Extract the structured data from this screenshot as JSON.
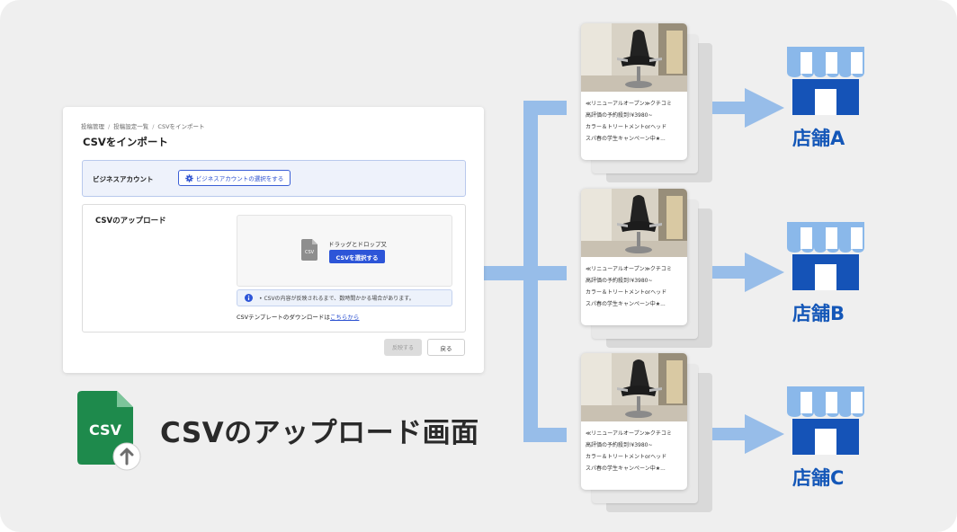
{
  "breadcrumb": [
    "投稿管理",
    "投稿設定一覧",
    "CSVをインポート"
  ],
  "page_title": "CSVをインポート",
  "business": {
    "label": "ビジネスアカウント",
    "button": "ビジネスアカウントの選択をする"
  },
  "upload": {
    "label": "CSVのアップロード",
    "file_icon_text": "CSV",
    "drop_text": "ドラッグとドロップ又",
    "select_button": "CSVを選択する",
    "info_text": "• CSVの内容が反映されるまで、数時間かかる場合があります。",
    "template_prefix": "CSVテンプレートのダウンロードは",
    "template_link": "こちらから"
  },
  "actions": {
    "submit": "反映する",
    "back": "戻る"
  },
  "big_icon_text": "CSV",
  "caption": "CSVのアップロード画面",
  "post": {
    "lines": [
      "≪リニューアルオープン≫クチコミ",
      "高評価の予約殺到!¥3980~",
      "カラー＆トリートメントorヘッド",
      "スパ春の学生キャンペーン中★..."
    ]
  },
  "stores": [
    "店舗A",
    "店舗B",
    "店舗C"
  ],
  "colors": {
    "background": "#efefef",
    "accent_blue": "#2d55d8",
    "arrow_blue": "#97bde9",
    "store_blue": "#1457b8",
    "csv_green": "#1e8a4c"
  },
  "icons": {
    "gear": "gear-icon",
    "info": "info-icon",
    "file": "csv-file-icon",
    "upload": "upload-arrow-icon",
    "store": "store-icon"
  }
}
